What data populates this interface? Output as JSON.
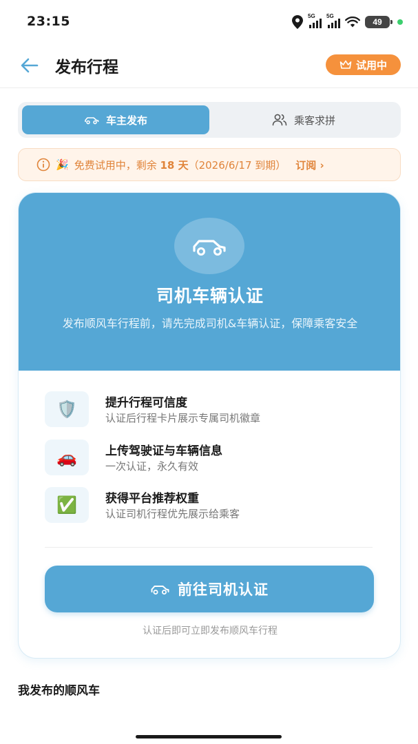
{
  "status_bar": {
    "time": "23:15",
    "signal_1_label": "5G",
    "signal_2_label": "5G",
    "battery": "49",
    "icons": [
      "location-icon",
      "signal-icon",
      "signal-icon",
      "wifi-icon",
      "battery-icon"
    ]
  },
  "header": {
    "title": "发布行程",
    "back_icon": "arrow-left-icon",
    "trial_badge": "试用中",
    "trial_icon": "crown-icon"
  },
  "tabs": [
    {
      "label": "车主发布",
      "icon": "car-icon",
      "active": true
    },
    {
      "label": "乘客求拼",
      "icon": "users-icon",
      "active": false
    }
  ],
  "notice": {
    "icon": "info-icon",
    "emoji": "🎉",
    "text_before": "免费试用中，剩余",
    "days": "18 天",
    "text_after": "（2026/6/17 到期）",
    "link": "订阅 ›"
  },
  "card": {
    "title": "司机车辆认证",
    "description": "发布顺风车行程前，请先完成司机&车辆认证，保障乘客安全",
    "features": [
      {
        "icon": "shield-icon",
        "emoji": "🛡️",
        "title": "提升行程可信度",
        "subtitle": "认证后行程卡片展示专属司机徽章"
      },
      {
        "icon": "car-icon",
        "emoji": "🚗",
        "title": "上传驾驶证与车辆信息",
        "subtitle": "一次认证，永久有效"
      },
      {
        "icon": "check-icon",
        "emoji": "✅",
        "title": "获得平台推荐权重",
        "subtitle": "认证司机行程优先展示给乘客"
      }
    ],
    "cta_label": "前往司机认证",
    "cta_note": "认证后即可立即发布顺风车行程"
  },
  "section": {
    "my_rides_title": "我发布的顺风车"
  },
  "colors": {
    "primary": "#55a7d5",
    "accent_orange": "#f5913c",
    "notice_text": "#e0843a",
    "notice_bg": "#fff4ea"
  }
}
